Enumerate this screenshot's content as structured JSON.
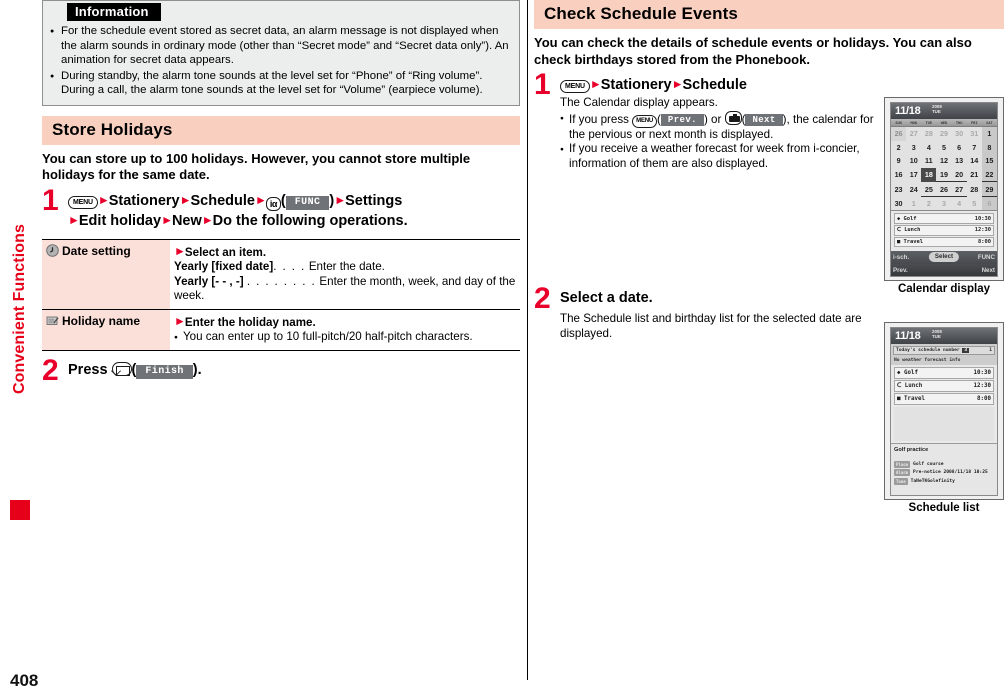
{
  "sidebar": {
    "chapter_label": "Convenient Functions"
  },
  "page_number": "408",
  "information": {
    "title": "Information",
    "bullets": [
      "For the schedule event stored as secret data, an alarm message is not displayed when the alarm sounds in ordinary mode (other than “Secret mode” and “Secret data only”). An animation for secret data appears.",
      "During standby, the alarm tone sounds at the level set for “Phone” of “Ring volume”. During a call, the alarm tone sounds at the level set for “Volume” (earpiece volume)."
    ]
  },
  "store_holidays": {
    "heading": "Store Holidays",
    "lead": "You can store up to 100 holidays. However, you cannot store multiple holidays for the same date.",
    "step1": {
      "number": "1",
      "key_menu": "MENU",
      "item_stationery": "Stationery",
      "item_schedule": "Schedule",
      "key_imode": "iα",
      "softkey_func": "FUNC",
      "item_settings": "Settings",
      "item_edit_holiday": "Edit holiday",
      "item_new": "New",
      "tail": "Do the following operations."
    },
    "table": {
      "rows": [
        {
          "icon": "clock-icon",
          "label": "Date setting",
          "head": "Select an item.",
          "lines": [
            {
              "term": "Yearly [fixed date]",
              "dots": ". . . .",
              "desc": "Enter the date."
            },
            {
              "term": "Yearly [- - , -]",
              "dots": ". . . . . . . .",
              "desc": "Enter the month, week, and day of the week."
            }
          ]
        },
        {
          "icon": "edit-icon",
          "label": "Holiday name",
          "head": "Enter the holiday name.",
          "note": "You can enter up to 10 full-pitch/20 half-pitch characters."
        }
      ]
    },
    "step2": {
      "number": "2",
      "press_label": "Press",
      "key_mail": "mail-key",
      "softkey_finish": "Finish",
      "period": "."
    }
  },
  "check_schedule": {
    "heading": "Check Schedule Events",
    "lead": "You can check the details of schedule events or holidays. You can also check birthdays stored from the Phonebook.",
    "step1": {
      "number": "1",
      "key_menu": "MENU",
      "item_stationery": "Stationery",
      "item_schedule": "Schedule",
      "body": "The Calendar display appears.",
      "bullets": [
        {
          "pre": "If you press",
          "key1": "MENU",
          "softkey1": "Prev.",
          "mid": "or",
          "key2": "camera-key",
          "softkey2": "Next",
          "post": ", the calendar for the pervious or next month is displayed."
        },
        {
          "text": "If you receive a weather forecast for week from i-concier, information of them are also displayed."
        }
      ]
    },
    "step2": {
      "number": "2",
      "title": "Select a date.",
      "body": "The Schedule list and birthday list for the selected date are displayed."
    }
  },
  "calendar_shot": {
    "caption": "Calendar display",
    "title_date": "11/18",
    "title_year": "2008",
    "title_dow": "TUE",
    "dow": [
      "SUN",
      "MON",
      "TUE",
      "WED",
      "THU",
      "FRI",
      "SAT"
    ],
    "weeks": [
      [
        "26",
        "27",
        "28",
        "29",
        "30",
        "31",
        "1"
      ],
      [
        "2",
        "3",
        "4",
        "5",
        "6",
        "7",
        "8"
      ],
      [
        "9",
        "10",
        "11",
        "12",
        "13",
        "14",
        "15"
      ],
      [
        "16",
        "17",
        "18",
        "19",
        "20",
        "21",
        "22"
      ],
      [
        "23",
        "24",
        "25",
        "26",
        "27",
        "28",
        "29"
      ],
      [
        "30",
        "1",
        "2",
        "3",
        "4",
        "5",
        "6"
      ]
    ],
    "events": [
      {
        "icon": "◆",
        "name": "Golf",
        "time": "10:30"
      },
      {
        "icon": "ᑕ",
        "name": "Lunch",
        "time": "12:30"
      },
      {
        "icon": "■",
        "name": "Travel",
        "time": "8:00"
      }
    ],
    "softkeys_top": {
      "left": "i-sch.",
      "center": "Select",
      "right": "FUNC"
    },
    "softkeys_bottom": {
      "left": "Prev.",
      "right": "Next"
    }
  },
  "schedule_list_shot": {
    "caption": "Schedule list",
    "title_date": "11/18",
    "title_year": "2008",
    "title_dow": "TUE",
    "count_bar_left": "Today's schedule number",
    "count_bar_badge": "3",
    "count_bar_right": "1",
    "weather_note": "No weather forecast info",
    "events": [
      {
        "icon": "◆",
        "name": "Golf",
        "time": "10:30"
      },
      {
        "icon": "ᑕ",
        "name": "Lunch",
        "time": "12:30"
      },
      {
        "icon": "■",
        "name": "Travel",
        "time": "8:00"
      }
    ],
    "detail_title": "Golf practice",
    "detail_rows": [
      {
        "tag": "Place",
        "value": "Golf course"
      },
      {
        "tag": "Alarm",
        "value": "Pre-notice 2008/11/18 10:25"
      },
      {
        "tag": "Tone",
        "value": "TaNeTKGolefinity"
      }
    ]
  },
  "colors": {
    "accent_red": "#e8002a",
    "header_bg": "#f9cfc0",
    "table_label_bg": "#fbe0da",
    "info_bg": "#eceded",
    "softkey_bg": "#6f7276"
  }
}
